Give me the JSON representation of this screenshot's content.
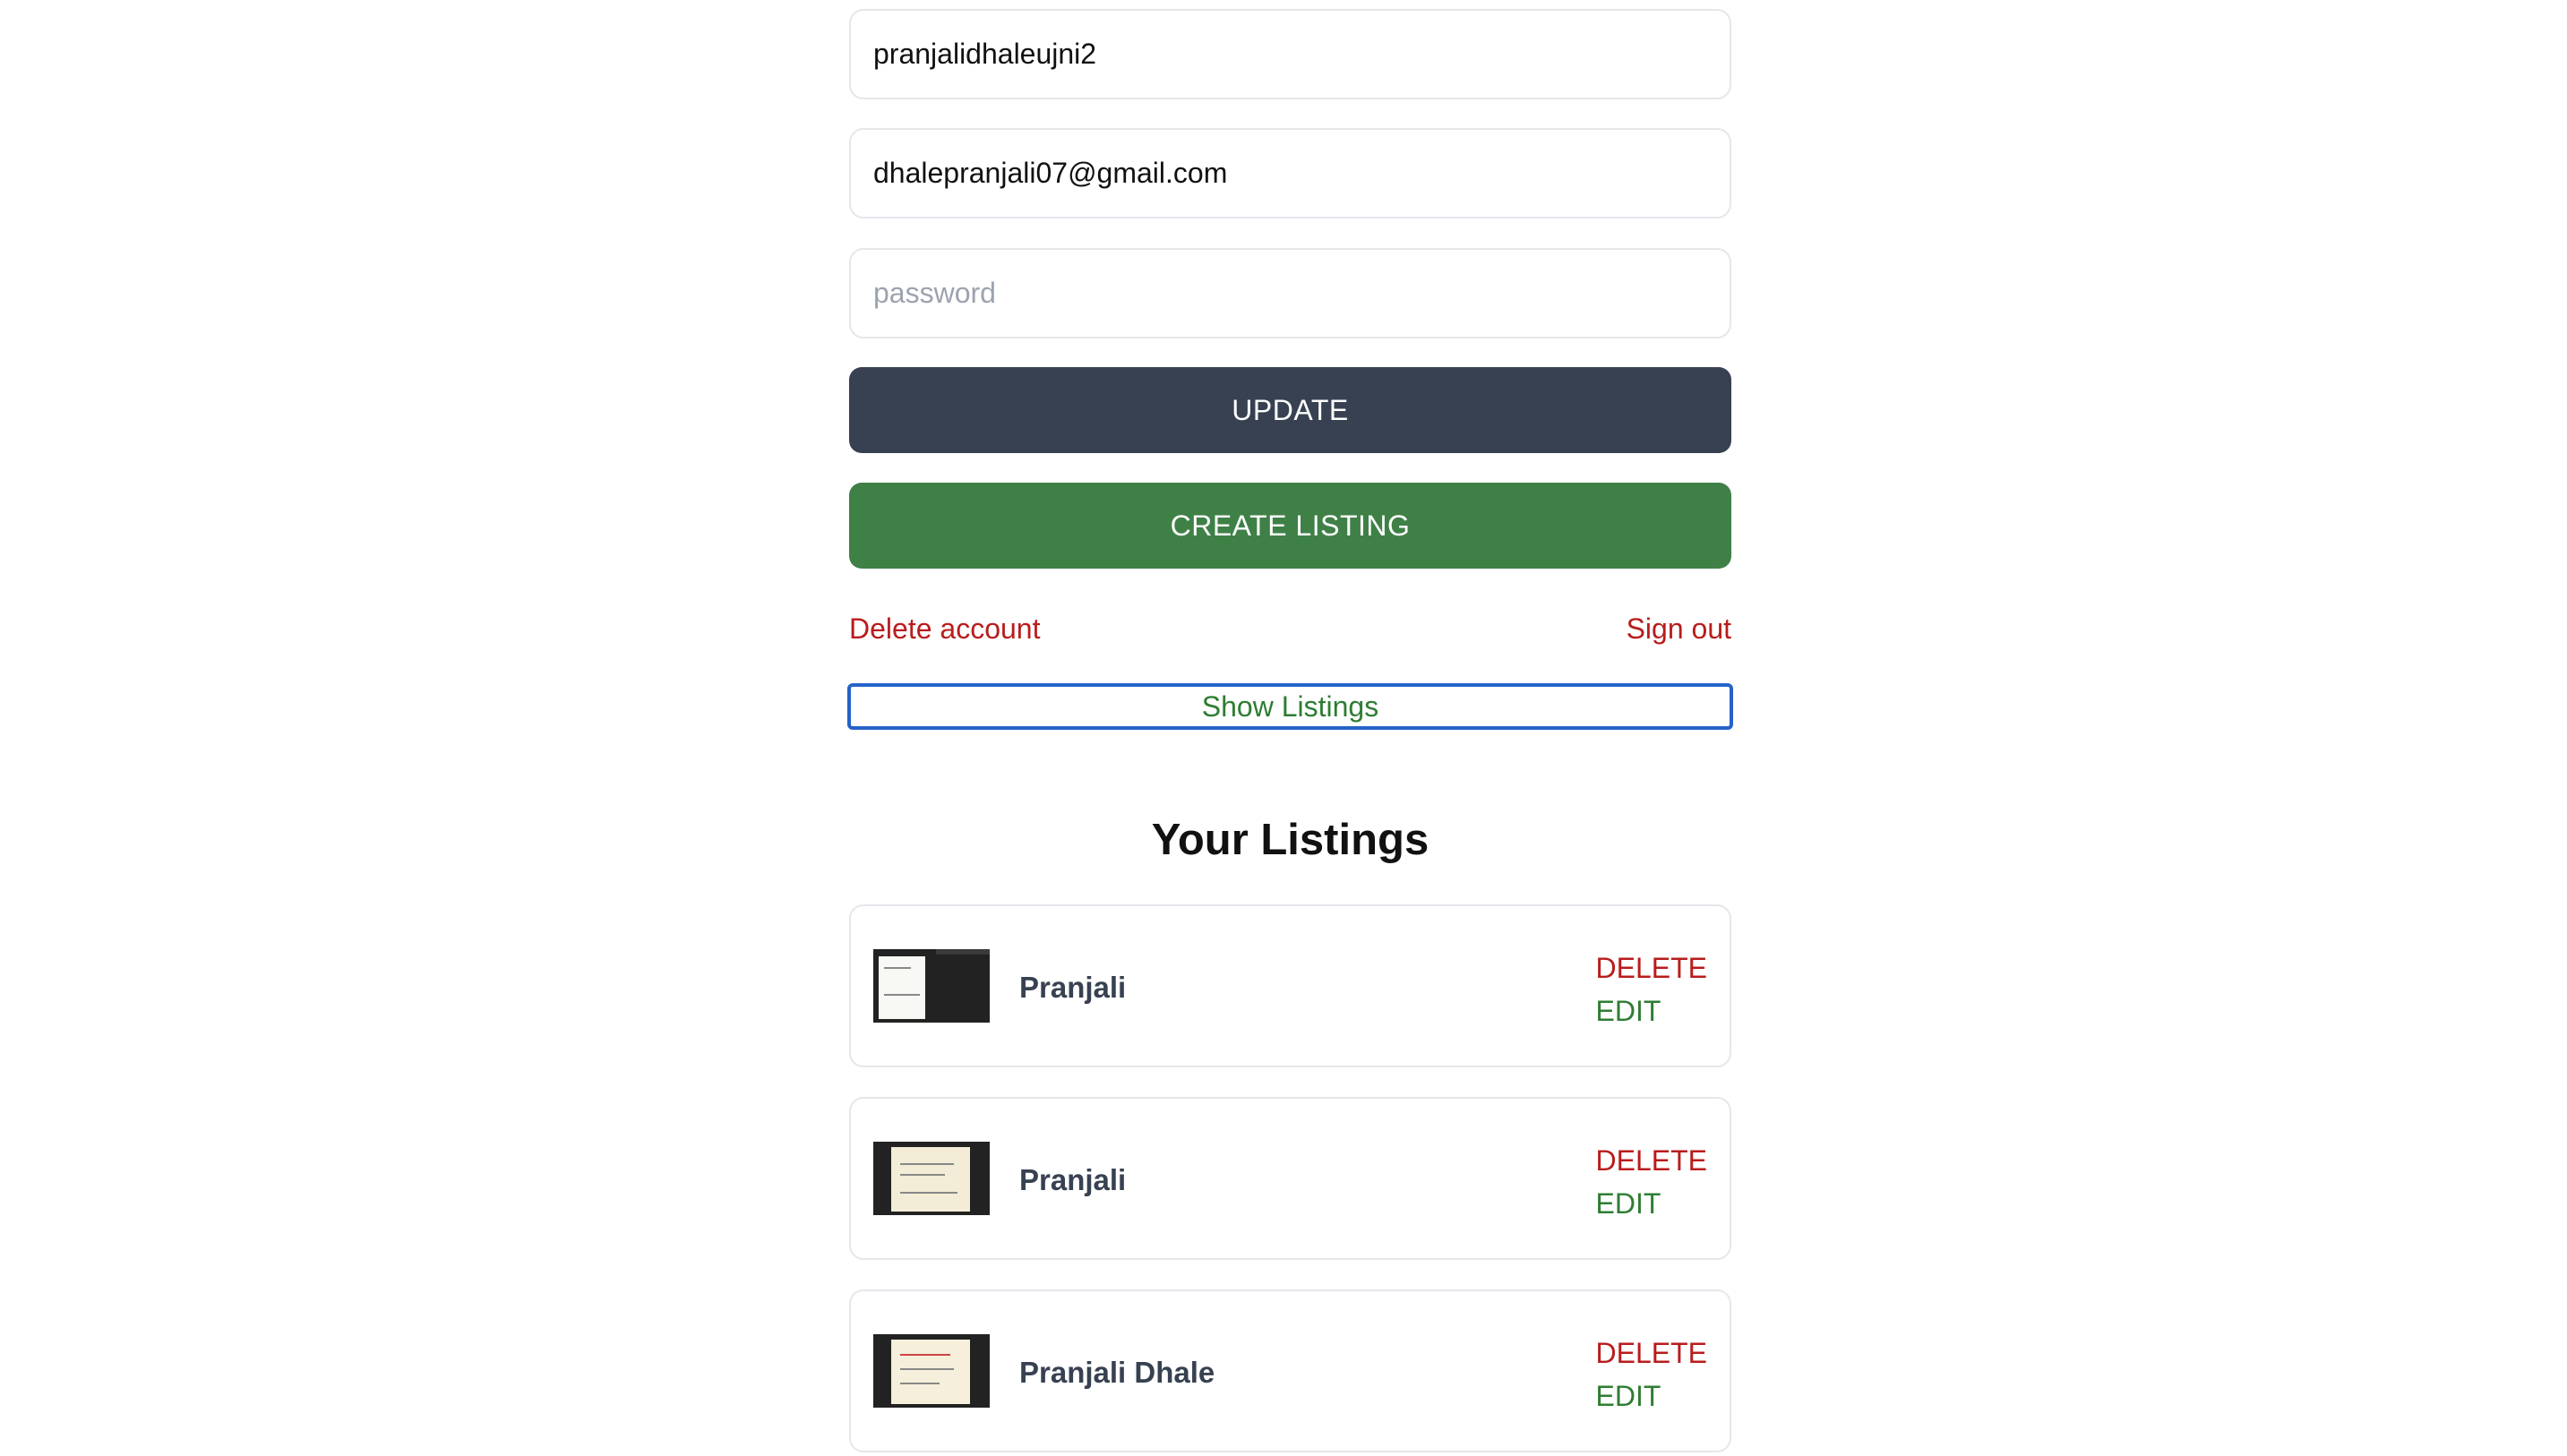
{
  "form": {
    "username_value": "pranjalidhaleujni2",
    "email_value": "dhalepranjali07@gmail.com",
    "password_placeholder": "password"
  },
  "buttons": {
    "update_label": "UPDATE",
    "create_listing_label": "CREATE LISTING",
    "delete_account_label": "Delete account",
    "sign_out_label": "Sign out",
    "show_listings_label": "Show Listings"
  },
  "listings": {
    "heading": "Your Listings",
    "items": [
      {
        "name": "Pranjali",
        "delete_label": "DELETE",
        "edit_label": "EDIT"
      },
      {
        "name": "Pranjali",
        "delete_label": "DELETE",
        "edit_label": "EDIT"
      },
      {
        "name": "Pranjali Dhale",
        "delete_label": "DELETE",
        "edit_label": "EDIT"
      }
    ]
  },
  "colors": {
    "update_bg": "#374151",
    "create_bg": "#3f8047",
    "danger": "#b91c1c",
    "success": "#2e7d32",
    "focus_border": "#2563c9"
  }
}
